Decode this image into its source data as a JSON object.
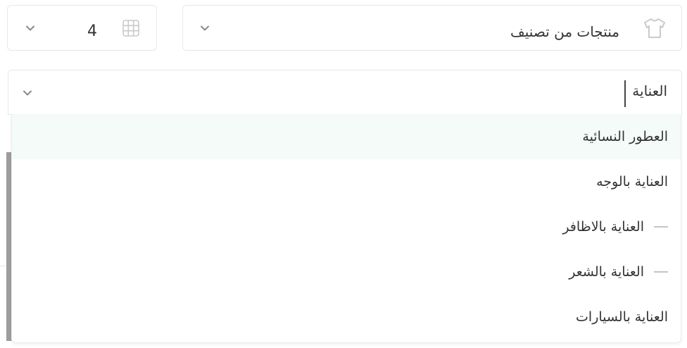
{
  "quantity_field": {
    "value": "4",
    "icon": "grid-icon",
    "dropdown_icon": "chevron-down-icon"
  },
  "category_field": {
    "value": "منتجات من تصنيف",
    "icon": "tshirt-icon",
    "dropdown_icon": "chevron-down-icon"
  },
  "search": {
    "value": "العناية",
    "dropdown_icon": "chevron-down-icon"
  },
  "options": [
    {
      "label": "العطور النسائية",
      "highlighted": true
    },
    {
      "label": "العناية بالوجه"
    },
    {
      "label": "العناية بالاظافر",
      "child": true
    },
    {
      "label": "العناية بالشعر",
      "child": true
    },
    {
      "label": "العناية بالسيارات"
    }
  ],
  "colors": {
    "highlight": "#f4fbf8",
    "border": "#e8e8e8",
    "text": "#333333"
  }
}
